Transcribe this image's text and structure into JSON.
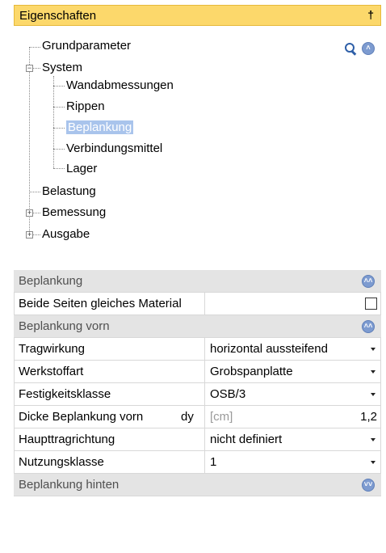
{
  "panel": {
    "title": "Eigenschaften",
    "pin_glyph": "†"
  },
  "tree": {
    "items": [
      {
        "label": "Grundparameter"
      },
      {
        "label": "System",
        "expander": "−"
      },
      {
        "label": "Wandabmessungen"
      },
      {
        "label": "Rippen"
      },
      {
        "label": "Beplankung",
        "selected": true
      },
      {
        "label": "Verbindungsmittel"
      },
      {
        "label": "Lager"
      },
      {
        "label": "Belastung"
      },
      {
        "label": "Bemessung",
        "expander": "+"
      },
      {
        "label": "Ausgabe",
        "expander": "+"
      }
    ],
    "tools": {
      "search_icon": "search-icon",
      "collapse_icon": "collapse-all-icon"
    }
  },
  "grid": {
    "sections": [
      {
        "title": "Beplankung",
        "icon_glyph": "˄˄"
      },
      {
        "title": "Beplankung vorn",
        "icon_glyph": "˄˄"
      },
      {
        "title": "Beplankung hinten",
        "icon_glyph": "˅˅"
      }
    ],
    "props": {
      "same_material": {
        "name": "Beide Seiten gleiches Material",
        "checked": false
      },
      "tragwirkung": {
        "name": "Tragwirkung",
        "value": "horizontal aussteifend"
      },
      "werkstoffart": {
        "name": "Werkstoffart",
        "value": "Grobspanplatte"
      },
      "festigkeitsklasse": {
        "name": "Festigkeitsklasse",
        "value": "OSB/3"
      },
      "dicke": {
        "name": "Dicke Beplankung vorn",
        "symbol": "dy",
        "unit": "[cm]",
        "value": "1,2"
      },
      "haupttragrichtung": {
        "name": "Haupttragrichtung",
        "value": "nicht definiert"
      },
      "nutzungsklasse": {
        "name": "Nutzungsklasse",
        "value": "1"
      }
    }
  },
  "colors": {
    "header_bg": "#fcd86b",
    "selection": "#a9c4ec",
    "category_bg": "#e4e4e4",
    "icon_blue": "#7d9bd0"
  }
}
